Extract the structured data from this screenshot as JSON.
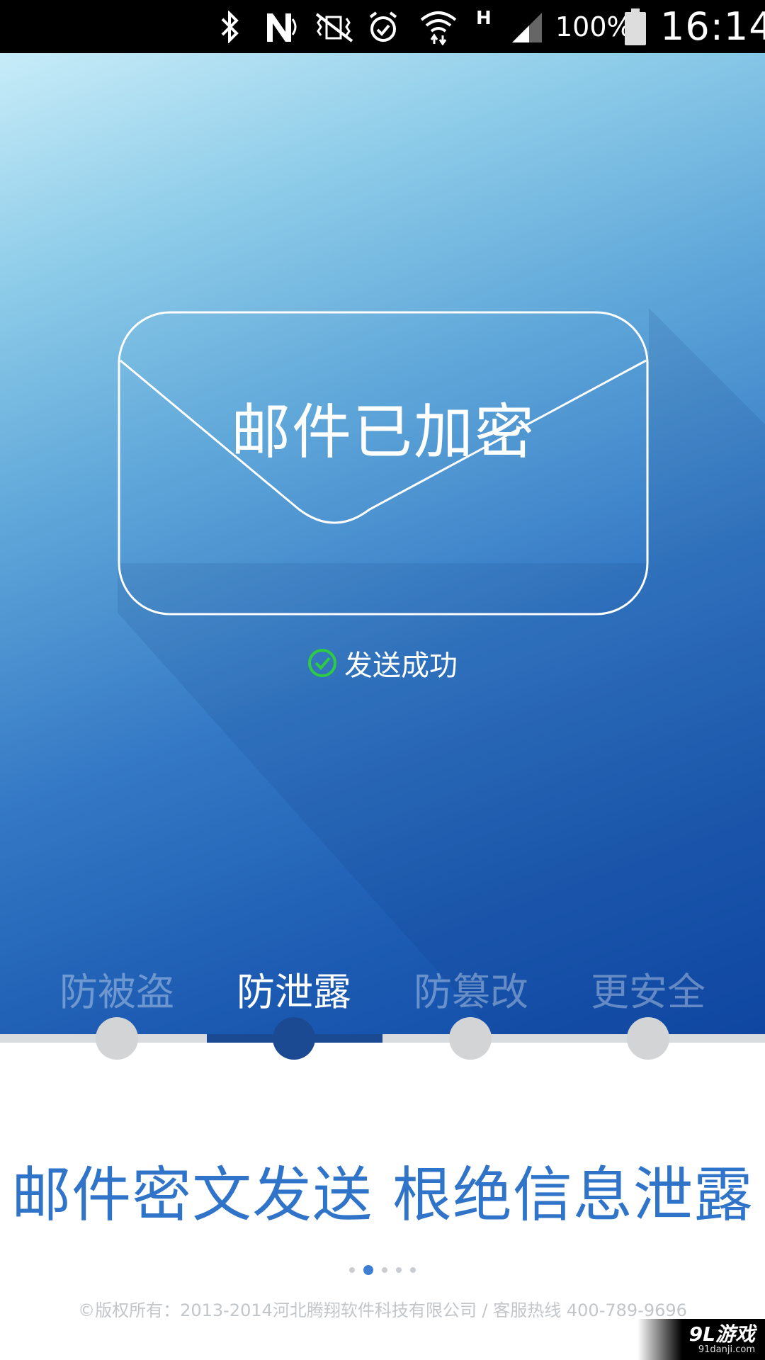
{
  "status_bar": {
    "battery_percent": "100%",
    "time": "16:14",
    "network_type": "H",
    "icons": [
      "bluetooth-icon",
      "nfc-icon",
      "vibrate-icon",
      "alarm-icon",
      "wifi-icon",
      "signal-icon",
      "battery-icon"
    ]
  },
  "hero": {
    "envelope_title": "邮件已加密",
    "status_text": "发送成功",
    "status_icon": "check-circle-icon",
    "status_color": "#2ecc40"
  },
  "tabs": [
    {
      "label": "防被盗",
      "active": false
    },
    {
      "label": "防泄露",
      "active": true
    },
    {
      "label": "防篡改",
      "active": false
    },
    {
      "label": "更安全",
      "active": false
    }
  ],
  "headline": "邮件密文发送 根绝信息泄露",
  "pager": {
    "count": 5,
    "active_index": 1
  },
  "footer": {
    "copyright": "©版权所有：2013-2014河北腾翔软件科技有限公司 / 客服热线 400-789-9696"
  },
  "watermark": {
    "main": "9L游戏",
    "sub": "91danji.com"
  },
  "colors": {
    "accent": "#1b4a92",
    "headline": "#2f74c9",
    "inactive_dot": "#d3d4d6"
  }
}
